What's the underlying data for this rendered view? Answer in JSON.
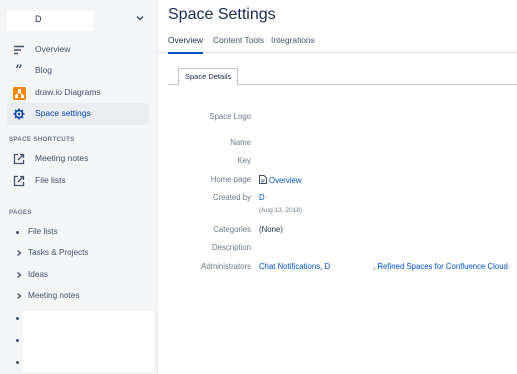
{
  "space": {
    "name": "D"
  },
  "sidebar": {
    "nav": [
      {
        "label": "Overview",
        "icon": "overview-lines-icon"
      },
      {
        "label": "Blog",
        "icon": "quote-icon"
      },
      {
        "label": "draw.io Diagrams",
        "icon": "drawio-icon"
      },
      {
        "label": "Space settings",
        "icon": "gear-icon",
        "active": true
      }
    ],
    "shortcuts_title": "SPACE SHORTCUTS",
    "shortcuts": [
      {
        "label": "Meeting notes",
        "icon": "external-link-icon"
      },
      {
        "label": "File lists",
        "icon": "external-link-icon"
      }
    ],
    "pages_title": "PAGES",
    "pages": [
      {
        "label": "File lists",
        "marker": "bullet"
      },
      {
        "label": "Tasks & Projects",
        "marker": "caret"
      },
      {
        "label": "Ideas",
        "marker": "caret"
      },
      {
        "label": "Meeting notes",
        "marker": "caret"
      }
    ]
  },
  "main": {
    "title": "Space Settings",
    "tabs": [
      "Overview",
      "Content Tools",
      "Integrations"
    ],
    "active_tab": "Overview",
    "subtab": "Space Details",
    "fields": {
      "logo_label": "Space Logo",
      "name_label": "Name",
      "key_label": "Key",
      "home_label": "Home page",
      "home_value": "Overview",
      "created_label": "Created by",
      "created_value": "D",
      "created_date": "(Aug 13, 2018)",
      "categories_label": "Categories",
      "categories_value": "(None)",
      "description_label": "Description",
      "admins_label": "Administrators",
      "admin_1": "Chat Notifications",
      "admin_sep": ",",
      "admin_2": "D",
      "admin_3": ", Refined Spaces for Confluence Cloud"
    }
  },
  "colors": {
    "accent": "#0052cc",
    "sidebar_bg": "#f4f5f7",
    "drawio": "#f08705"
  }
}
